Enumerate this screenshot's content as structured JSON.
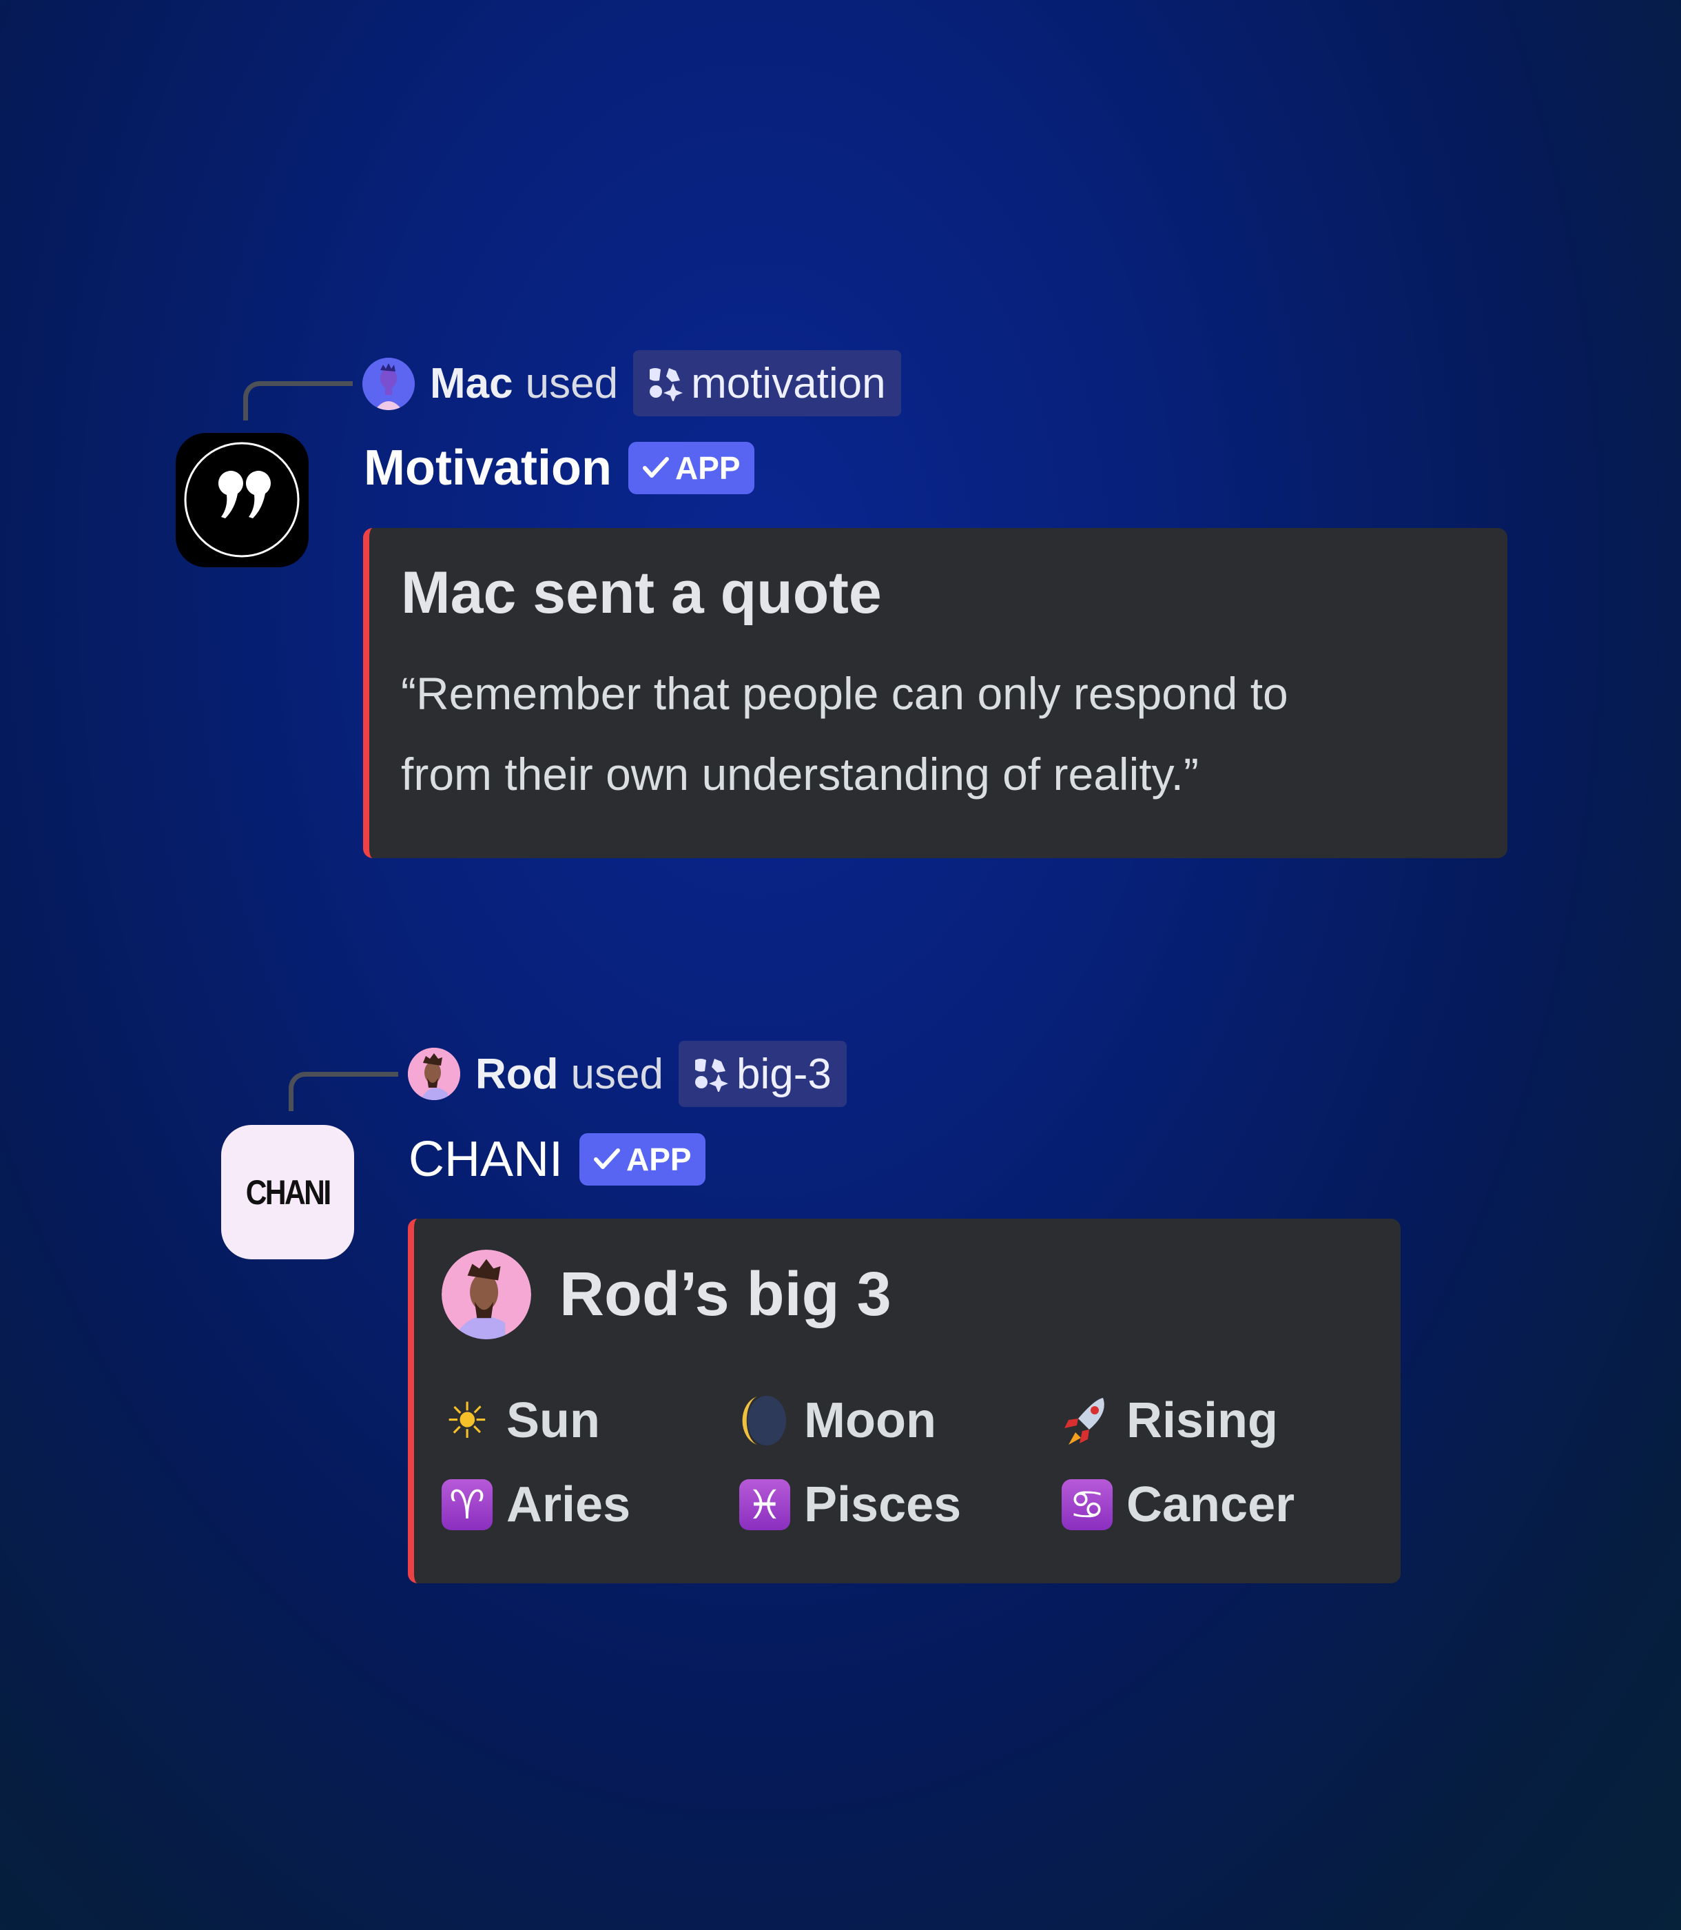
{
  "messages": [
    {
      "user": "Mac",
      "used_label": "used",
      "command": "motivation",
      "command_icon": "app-command-icon",
      "app_name": "Motivation",
      "app_badge": "APP",
      "app_icon": "quote-marks-icon",
      "embed": {
        "title": "Mac sent a quote",
        "description_line1": "“Remember that people can only respond to",
        "description_line2": "from their own understanding of reality.”",
        "accent_color": "#ed4245"
      }
    },
    {
      "user": "Rod",
      "used_label": "used",
      "command": "big-3",
      "command_icon": "app-command-icon",
      "app_name": "CHANI",
      "app_badge": "APP",
      "app_icon_text": "CHANI",
      "embed": {
        "title": "Rod’s big 3",
        "accent_color": "#ed4245",
        "fields": [
          {
            "name": "Sun",
            "icon": "sun-icon",
            "glyph": "☀"
          },
          {
            "name": "Moon",
            "icon": "moon-icon",
            "glyph": "🌘"
          },
          {
            "name": "Rising",
            "icon": "rocket-icon",
            "glyph": "🚀"
          },
          {
            "name": "Aries",
            "icon": "aries-icon",
            "glyph": "♈"
          },
          {
            "name": "Pisces",
            "icon": "pisces-icon",
            "glyph": "♓"
          },
          {
            "name": "Cancer",
            "icon": "cancer-icon",
            "glyph": "♋"
          }
        ]
      }
    }
  ],
  "colors": {
    "brand": "#5865f2",
    "embed_bg": "#2b2d31",
    "pill_bg": "#2c3580"
  }
}
